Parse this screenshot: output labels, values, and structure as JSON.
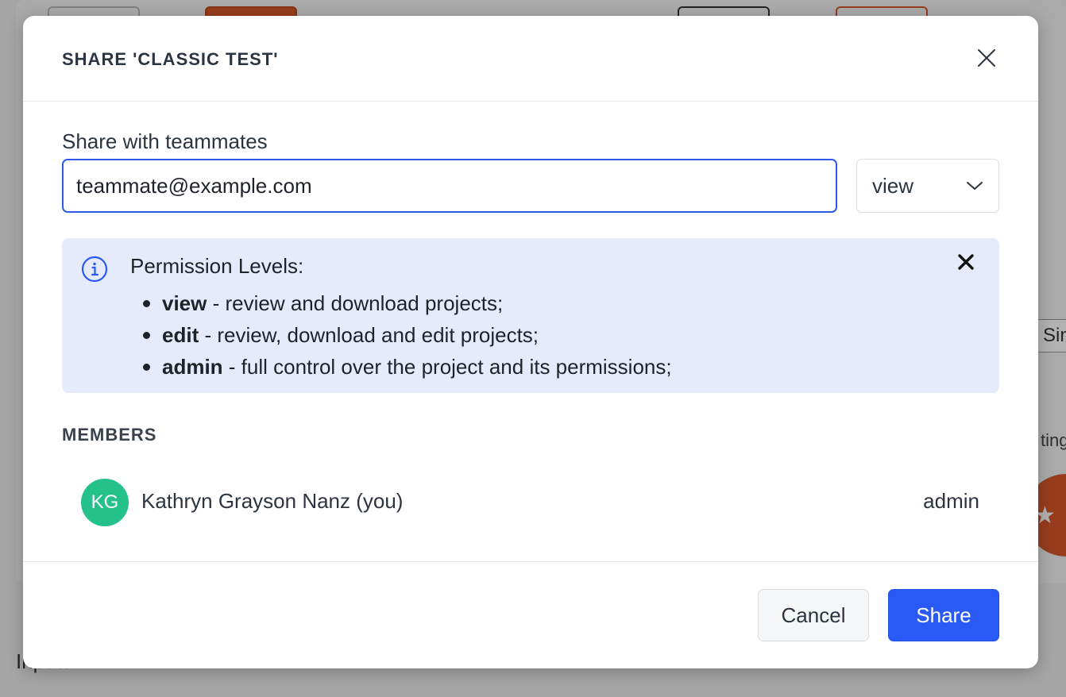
{
  "background": {
    "partial_text_right": "Sin",
    "partial_text_right2": "ting",
    "partial_text_bottom": "Inputs",
    "fab_icon": "star-icon"
  },
  "modal": {
    "title": "SHARE 'CLASSIC TEST'",
    "close_icon": "close-icon"
  },
  "share": {
    "label": "Share with teammates",
    "email_value": "teammate@example.com",
    "permission_selected": "view",
    "permission_icon": "chevron-down-icon"
  },
  "info": {
    "icon": "info-icon",
    "title": "Permission Levels:",
    "levels": [
      {
        "name": "view",
        "description": " - review and download projects;"
      },
      {
        "name": "edit",
        "description": " - review, download and edit projects;"
      },
      {
        "name": "admin",
        "description": " - full control over the project and its permissions;"
      }
    ]
  },
  "members": {
    "label": "MEMBERS",
    "items": [
      {
        "initials": "KG",
        "name": "Kathryn Grayson Nanz (you)",
        "role": "admin",
        "avatar_color": "#24c28a"
      }
    ]
  },
  "footer": {
    "cancel_label": "Cancel",
    "share_label": "Share"
  },
  "colors": {
    "accent": "#2a5af5",
    "info_bg": "#e6ebfb",
    "avatar": "#24c28a",
    "brand_orange": "#d8582a"
  }
}
